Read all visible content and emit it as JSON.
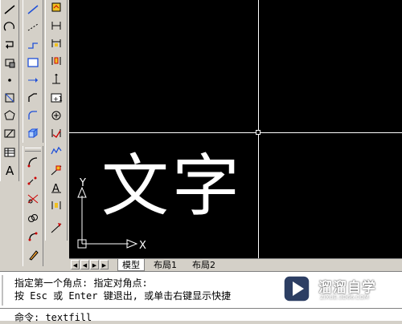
{
  "toolbars": {
    "draw": [
      "line-icon",
      "arc-icon",
      "redo-icon",
      "region-icon",
      "point-icon",
      "rectangle-icon",
      "polygon-icon",
      "hatch-icon",
      "table-icon",
      "text-icon"
    ],
    "modify": [
      "construction-line-icon",
      "polyline-icon",
      "spline-icon",
      "rectangle-icon",
      "move-icon",
      "polyline-edit-icon",
      "fillet-icon",
      "3d-box-icon"
    ],
    "modify2": [
      "edit-curve-icon",
      "stretch-icon",
      "scale-icon",
      "copy-icon",
      "mirror-icon",
      "paint-icon"
    ],
    "dimension": [
      "dim-linear-icon",
      "dim-horizontal-icon",
      "dim-continue-icon",
      "dim-baseline-icon",
      "dim-ordinate-icon",
      "dim-datum-icon",
      "dim-center-icon",
      "dim-angle-icon",
      "dim-arc-icon",
      "dim-leader-icon",
      "dim-text-icon",
      "dim-tolerance-icon",
      "dim-update-icon"
    ]
  },
  "drawing": {
    "text": "文字",
    "ucs": {
      "x_label": "X",
      "y_label": "Y"
    }
  },
  "tabs": [
    "模型",
    "布局1",
    "布局2"
  ],
  "command": {
    "line1": "指定第一个角点: 指定对角点:",
    "line2": "按 Esc 或 Enter 键退出, 或单击右键显示快捷",
    "prompt": "命令: textfill"
  },
  "watermark": {
    "name": "溜溜自学",
    "url": "ZIXUE.3D66.COM"
  }
}
